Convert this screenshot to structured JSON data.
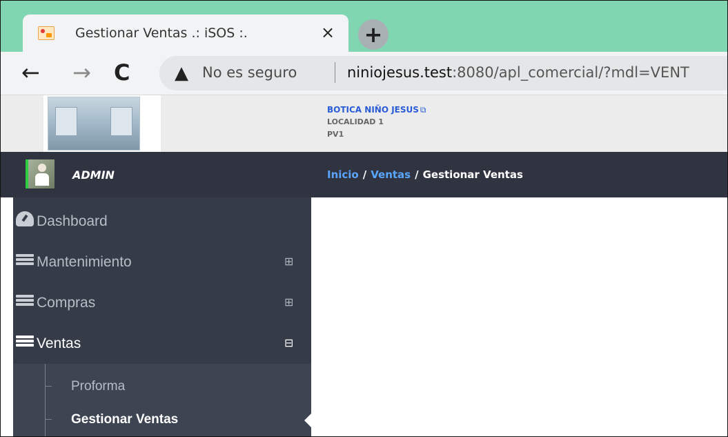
{
  "browser": {
    "tab_title": "Gestionar Ventas .: iSOS :.",
    "tab_close": "×",
    "new_tab": "+",
    "nav_back": "←",
    "nav_forward": "→",
    "nav_reload": "C",
    "security_icon": "▲",
    "security_label": "No es seguro",
    "url_host": "niniojesus.test",
    "url_rest": ":8080/apl_comercial/?mdl=VENT",
    "tab_color": "#7fd6b0"
  },
  "header": {
    "company_name": "BOTICA NIÑO JESUS",
    "external_icon": "⧉",
    "location": "LOCALIDAD 1",
    "point_of_sale": "PV1"
  },
  "user": {
    "name": "ADMIN"
  },
  "breadcrumb": {
    "home": "Inicio",
    "sep": "/",
    "section": "Ventas",
    "current": "Gestionar Ventas"
  },
  "sidebar": {
    "items": [
      {
        "label": "Dashboard",
        "icon": "dashboard-gauge-icon"
      },
      {
        "label": "Mantenimiento",
        "icon": "list-icon",
        "toggle": "⊞"
      },
      {
        "label": "Compras",
        "icon": "list-icon",
        "toggle": "⊞"
      },
      {
        "label": "Ventas",
        "icon": "list-icon",
        "toggle": "⊟"
      }
    ],
    "submenu": [
      {
        "label": "Proforma"
      },
      {
        "label": "Gestionar Ventas"
      }
    ],
    "bg_color": "#353b47",
    "active_color": "#ffffff"
  }
}
